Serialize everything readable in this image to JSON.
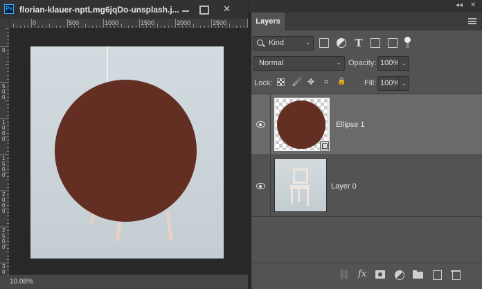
{
  "document": {
    "title": "florian-klauer-nptLmg6jqDo-unsplash.j...",
    "app_badge": "Ps",
    "close_glyph": "✕",
    "zoom": "10.08%",
    "horizontal_ruler_labels": [
      "0",
      "500",
      "1000",
      "1500",
      "2000",
      "2500"
    ],
    "vertical_ruler_labels": [
      "0",
      "5\n0\n0",
      "1\n0\n0\n0",
      "1\n5\n0\n0",
      "2\n0\n0\n0",
      "2\n5\n0\n0",
      "3\n0\n0\n0"
    ],
    "ellipse_color": "#622f22"
  },
  "panel": {
    "collapse_glyph": "◂◂",
    "tab_label": "Layers",
    "kind_filter": {
      "value": "Kind",
      "caret": "⌄"
    },
    "filter_icons": [
      "pixel-filter-icon",
      "adjustment-filter-icon",
      "type-filter-icon",
      "shape-filter-icon",
      "smart-object-filter-icon",
      "filter-toggle"
    ],
    "blend_mode": {
      "value": "Normal",
      "caret": "⌄"
    },
    "opacity": {
      "label": "Opacity:",
      "value": "100%",
      "caret": "⌄"
    },
    "lock": {
      "label": "Lock:",
      "icons": [
        "lock-transparent-icon",
        "lock-paint-icon",
        "lock-move-icon",
        "lock-artboard-icon",
        "lock-all-icon"
      ],
      "paint_glyph": "🖌",
      "move_glyph": "✥",
      "artboard_glyph": "⌗",
      "all_glyph": "🔒"
    },
    "fill": {
      "label": "Fill:",
      "value": "100%",
      "caret": "⌄"
    },
    "layers": [
      {
        "name": "Ellipse 1",
        "selected": true,
        "visible": true,
        "kind": "shape"
      },
      {
        "name": "Layer 0",
        "selected": false,
        "visible": true,
        "kind": "pixel"
      }
    ],
    "footer_icons": {
      "link": "⛓",
      "fx": "fx",
      "mask": "mask-icon",
      "adjustment": "adjustment-layer-icon",
      "group": "group-icon",
      "new_layer": "new-layer-icon",
      "delete": "delete-icon"
    }
  },
  "colors": {
    "panel_bg": "#535353",
    "selected_row": "#6a6a6a",
    "ellipse_fill": "#622f22",
    "ps_blue": "#31a8ff"
  }
}
